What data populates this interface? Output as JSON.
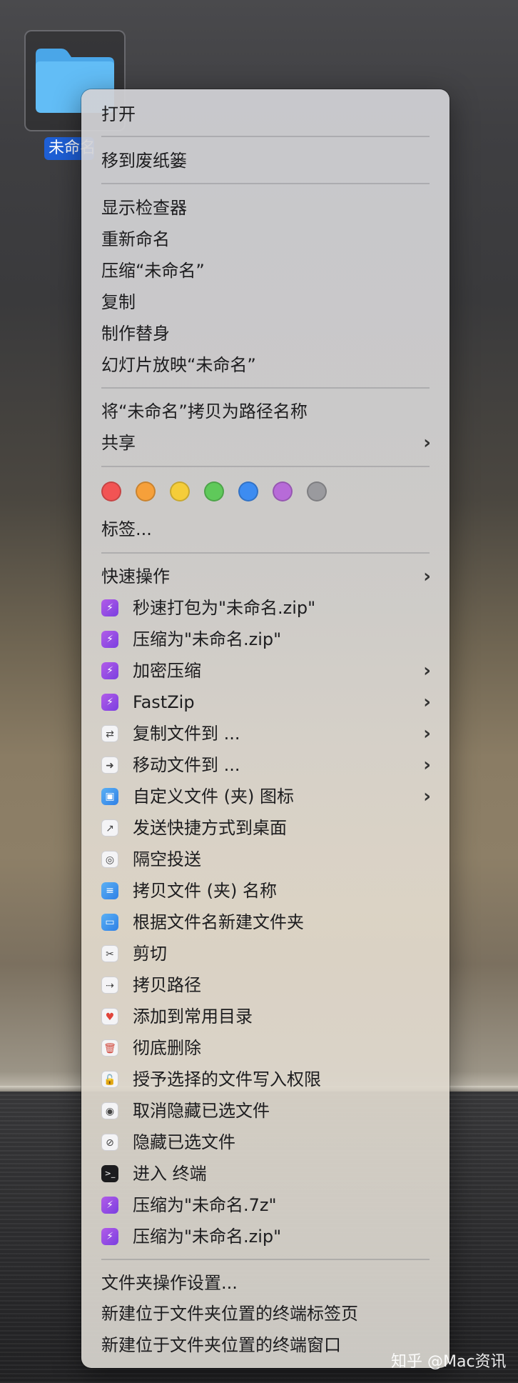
{
  "desktop": {
    "folder_label": "未命名"
  },
  "menu": {
    "open": "打开",
    "move_to_trash": "移到废纸篓",
    "get_info": "显示检查器",
    "rename": "重新命名",
    "compress": "压缩“未命名”",
    "duplicate": "复制",
    "make_alias": "制作替身",
    "slideshow": "幻灯片放映“未命名”",
    "copy_as_path": "将“未命名”拷贝为路径名称",
    "share": "共享",
    "tag_colors": [
      "#f25454",
      "#f6a03a",
      "#f5cd3a",
      "#5fc95a",
      "#3d8cf1",
      "#b76bd8",
      "#9a9a9e"
    ],
    "tags": "标签...",
    "quick_actions": "快速操作",
    "actions": [
      {
        "label": "秒速打包为\"未命名.zip\"",
        "icon": "zip-bolt-icon",
        "has_submenu": false
      },
      {
        "label": "压缩为\"未命名.zip\"",
        "icon": "zip-bolt-icon",
        "has_submenu": false
      },
      {
        "label": "加密压缩",
        "icon": "zip-bolt-icon",
        "has_submenu": true
      },
      {
        "label": "FastZip",
        "icon": "zip-bolt-icon",
        "has_submenu": true
      },
      {
        "label": "复制文件到 ...",
        "icon": "copy-arrows-icon",
        "has_submenu": true
      },
      {
        "label": "移动文件到 ...",
        "icon": "move-arrow-icon",
        "has_submenu": true
      },
      {
        "label": "自定义文件 (夹) 图标",
        "icon": "folder-image-icon",
        "has_submenu": true
      },
      {
        "label": "发送快捷方式到桌面",
        "icon": "shortcut-arrow-icon",
        "has_submenu": false
      },
      {
        "label": "隔空投送",
        "icon": "airdrop-icon",
        "has_submenu": false
      },
      {
        "label": "拷贝文件 (夹) 名称",
        "icon": "copy-name-icon",
        "has_submenu": false
      },
      {
        "label": "根据文件名新建文件夹",
        "icon": "new-folder-icon",
        "has_submenu": false
      },
      {
        "label": "剪切",
        "icon": "scissors-icon",
        "has_submenu": false
      },
      {
        "label": "拷贝路径",
        "icon": "path-icon",
        "has_submenu": false
      },
      {
        "label": "添加到常用目录",
        "icon": "heart-folder-icon",
        "has_submenu": false
      },
      {
        "label": "彻底删除",
        "icon": "trash-icon",
        "has_submenu": false
      },
      {
        "label": "授予选择的文件写入权限",
        "icon": "unlock-icon",
        "has_submenu": false
      },
      {
        "label": "取消隐藏已选文件",
        "icon": "eye-icon",
        "has_submenu": false
      },
      {
        "label": "隐藏已选文件",
        "icon": "eye-slash-icon",
        "has_submenu": false
      },
      {
        "label": "进入 终端",
        "icon": "terminal-icon",
        "has_submenu": false
      },
      {
        "label": "压缩为\"未命名.7z\"",
        "icon": "zip-bolt-icon",
        "has_submenu": false
      },
      {
        "label": "压缩为\"未命名.zip\"",
        "icon": "zip-bolt-icon",
        "has_submenu": false
      }
    ],
    "folder_actions_setup": "文件夹操作设置...",
    "new_terminal_tab": "新建位于文件夹位置的终端标签页",
    "new_terminal_window": "新建位于文件夹位置的终端窗口"
  },
  "watermark": "知乎 @Mac资讯"
}
